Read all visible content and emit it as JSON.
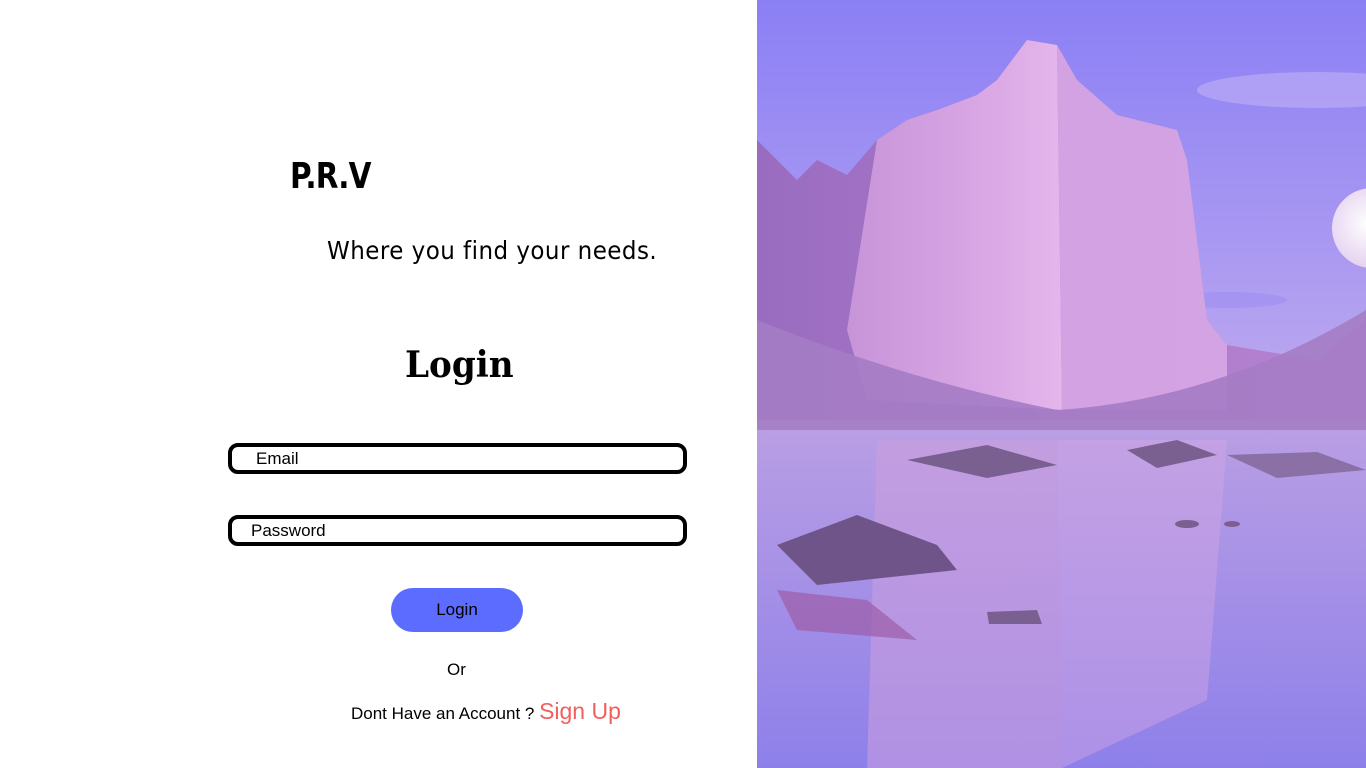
{
  "brand": {
    "name": "P.R.V",
    "tagline": "Where you find your needs."
  },
  "login_form": {
    "heading": "Login",
    "email_placeholder": "Email",
    "password_placeholder": "Password",
    "submit_label": "Login",
    "divider_text": "Or",
    "signup_prompt": "Dont Have  an Account ? ",
    "signup_link": "Sign Up"
  },
  "colors": {
    "button": "#5b6cff",
    "signup_link": "#f0605e",
    "scene_sky": "#8f82f5"
  },
  "hero_image": {
    "subject": "purple cliff reflected in lake under moon"
  }
}
